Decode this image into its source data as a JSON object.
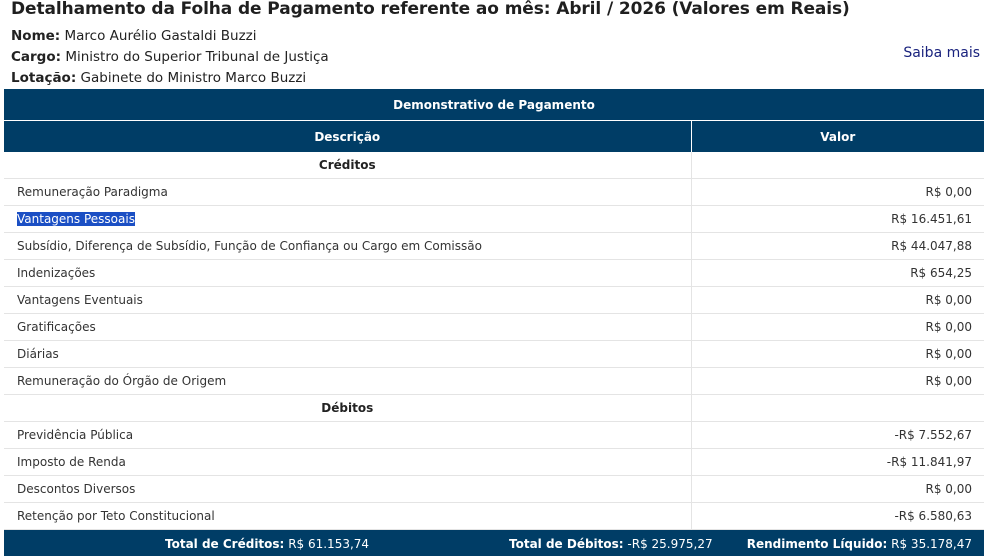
{
  "page": {
    "title": "Detalhamento da Folha de Pagamento referente ao mês: Abril / 2026 (Valores em Reais)",
    "nome_label": "Nome:",
    "nome": "Marco Aurélio Gastaldi Buzzi",
    "cargo_label": "Cargo:",
    "cargo": "Ministro do Superior Tribunal de Justiça",
    "lotacao_label": "Lotação:",
    "lotacao": "Gabinete do Ministro Marco Buzzi",
    "saiba_mais": "Saiba mais"
  },
  "table": {
    "caption": "Demonstrativo de Pagamento",
    "col_descricao": "Descrição",
    "col_valor": "Valor",
    "creditos_label": "Créditos",
    "creditos": [
      {
        "desc": "Remuneração Paradigma",
        "valor": "R$ 0,00"
      },
      {
        "desc": "Vantagens Pessoais",
        "valor": "R$ 16.451,61"
      },
      {
        "desc": "Subsídio, Diferença de Subsídio, Função de Confiança ou Cargo em Comissão",
        "valor": "R$ 44.047,88"
      },
      {
        "desc": "Indenizações",
        "valor": "R$ 654,25"
      },
      {
        "desc": "Vantagens Eventuais",
        "valor": "R$ 0,00"
      },
      {
        "desc": "Gratificações",
        "valor": "R$ 0,00"
      },
      {
        "desc": "Diárias",
        "valor": "R$ 0,00"
      },
      {
        "desc": "Remuneração do Órgão de Origem",
        "valor": "R$ 0,00"
      }
    ],
    "debitos_label": "Débitos",
    "debitos": [
      {
        "desc": "Previdência Pública",
        "valor": "-R$ 7.552,67"
      },
      {
        "desc": "Imposto de Renda",
        "valor": "-R$ 11.841,97"
      },
      {
        "desc": "Descontos Diversos",
        "valor": "R$ 0,00"
      },
      {
        "desc": "Retenção por Teto Constitucional",
        "valor": "-R$ 6.580,63"
      }
    ],
    "footer": {
      "creditos_label": "Total de Créditos:",
      "creditos_value": "R$ 61.153,74",
      "debitos_label": "Total de Débitos:",
      "debitos_value": "-R$ 25.975,27",
      "liquido_label": "Rendimento Líquido:",
      "liquido_value": "R$ 35.178,47"
    }
  },
  "colors": {
    "header_bg": "#003d66",
    "selection_bg": "#1b4fc4",
    "link": "#1a237e"
  }
}
